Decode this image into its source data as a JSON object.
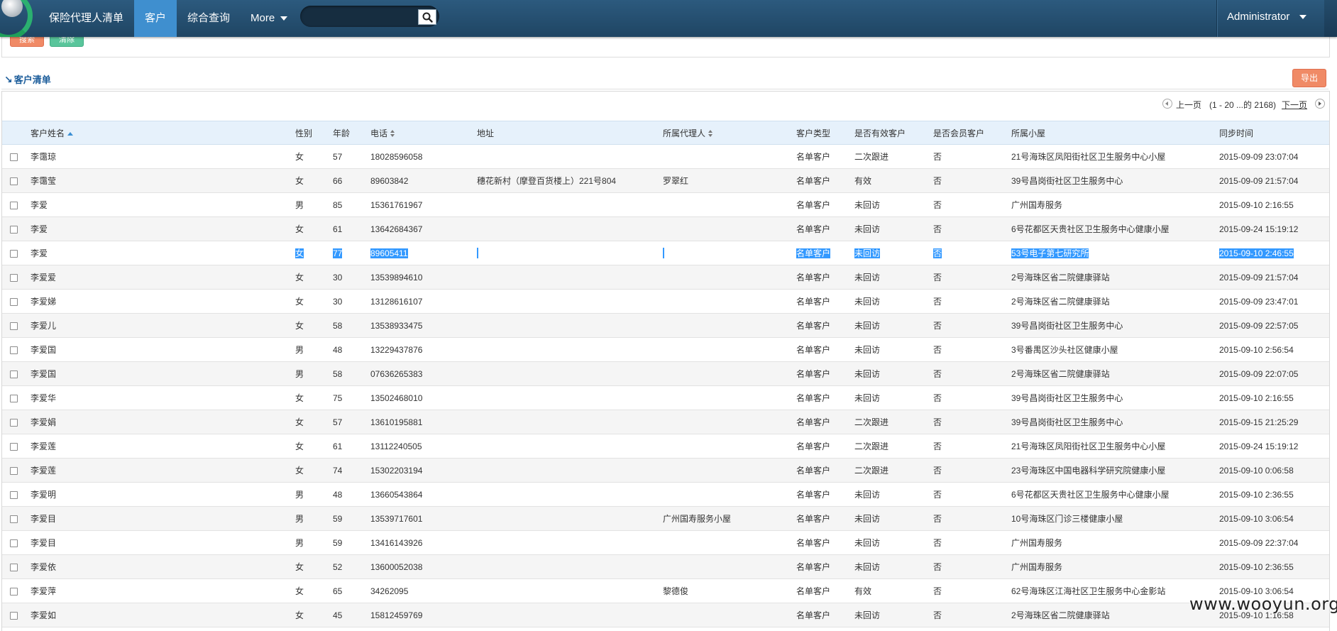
{
  "nav": {
    "app_title": "保险代理人清单",
    "items": [
      {
        "label": "客户",
        "active": true
      },
      {
        "label": "综合查询",
        "active": false
      },
      {
        "label": "More",
        "active": false
      }
    ],
    "search_placeholder": "",
    "user": "Administrator"
  },
  "search_panel": {
    "search_label": "搜索",
    "clear_label": "清除"
  },
  "list": {
    "title": "客户清单",
    "export_label": "导出"
  },
  "pager": {
    "prev_label": "上一页",
    "range_text": "(1 - 20 ...的 2168)",
    "next_label": "下一页"
  },
  "columns": [
    "客户姓名",
    "性别",
    "年龄",
    "电话",
    "地址",
    "所属代理人",
    "客户类型",
    "是否有效客户",
    "是否会员客户",
    "所属小屋",
    "同步时间"
  ],
  "rows": [
    {
      "name": "李霭琼",
      "sex": "女",
      "age": "57",
      "phone": "18028596058",
      "addr": "",
      "agent": "",
      "type": "名单客户",
      "valid": "二次跟进",
      "member": "否",
      "house": "21号海珠区凤阳街社区卫生服务中心小屋",
      "time": "2015-09-09 23:07:04"
    },
    {
      "name": "李霭莹",
      "sex": "女",
      "age": "66",
      "phone": "89603842",
      "addr": "穗花新村（摩登百货楼上）221号804",
      "agent": "罗翠红",
      "type": "名单客户",
      "valid": "有效",
      "member": "否",
      "house": "39号昌岗街社区卫生服务中心",
      "time": "2015-09-09 21:57:04"
    },
    {
      "name": "李爱",
      "sex": "男",
      "age": "85",
      "phone": "15361761967",
      "addr": "",
      "agent": "",
      "type": "名单客户",
      "valid": "未回访",
      "member": "否",
      "house": "广州国寿服务",
      "time": "2015-09-10 2:16:55"
    },
    {
      "name": "李爱",
      "sex": "女",
      "age": "61",
      "phone": "13642684367",
      "addr": "",
      "agent": "",
      "type": "名单客户",
      "valid": "未回访",
      "member": "否",
      "house": "6号花都区天贵社区卫生服务中心健康小屋",
      "time": "2015-09-24 15:19:12"
    },
    {
      "name": "李爱",
      "sex": "女",
      "age": "77",
      "phone": "89605411",
      "addr": "",
      "agent": "",
      "type": "名单客户",
      "valid": "未回访",
      "member": "否",
      "house": "53号电子第七研究所",
      "time": "2015-09-10 2:46:55",
      "selected": true
    },
    {
      "name": "李爱爱",
      "sex": "女",
      "age": "30",
      "phone": "13539894610",
      "addr": "",
      "agent": "",
      "type": "名单客户",
      "valid": "未回访",
      "member": "否",
      "house": "2号海珠区省二院健康驿站",
      "time": "2015-09-09 21:57:04"
    },
    {
      "name": "李爱娣",
      "sex": "女",
      "age": "30",
      "phone": "13128616107",
      "addr": "",
      "agent": "",
      "type": "名单客户",
      "valid": "未回访",
      "member": "否",
      "house": "2号海珠区省二院健康驿站",
      "time": "2015-09-09 23:47:01"
    },
    {
      "name": "李爱儿",
      "sex": "女",
      "age": "58",
      "phone": "13538933475",
      "addr": "",
      "agent": "",
      "type": "名单客户",
      "valid": "未回访",
      "member": "否",
      "house": "39号昌岗街社区卫生服务中心",
      "time": "2015-09-09 22:57:05"
    },
    {
      "name": "李爱国",
      "sex": "男",
      "age": "48",
      "phone": "13229437876",
      "addr": "",
      "agent": "",
      "type": "名单客户",
      "valid": "未回访",
      "member": "否",
      "house": "3号番禺区沙头社区健康小屋",
      "time": "2015-09-10 2:56:54"
    },
    {
      "name": "李爱国",
      "sex": "男",
      "age": "58",
      "phone": "07636265383",
      "addr": "",
      "agent": "",
      "type": "名单客户",
      "valid": "未回访",
      "member": "否",
      "house": "2号海珠区省二院健康驿站",
      "time": "2015-09-09 22:07:05"
    },
    {
      "name": "李爱华",
      "sex": "女",
      "age": "75",
      "phone": "13502468010",
      "addr": "",
      "agent": "",
      "type": "名单客户",
      "valid": "未回访",
      "member": "否",
      "house": "39号昌岗街社区卫生服务中心",
      "time": "2015-09-10 2:16:55"
    },
    {
      "name": "李爱娟",
      "sex": "女",
      "age": "57",
      "phone": "13610195881",
      "addr": "",
      "agent": "",
      "type": "名单客户",
      "valid": "二次跟进",
      "member": "否",
      "house": "39号昌岗街社区卫生服务中心",
      "time": "2015-09-15 21:25:29"
    },
    {
      "name": "李爱莲",
      "sex": "女",
      "age": "61",
      "phone": "13112240505",
      "addr": "",
      "agent": "",
      "type": "名单客户",
      "valid": "二次跟进",
      "member": "否",
      "house": "21号海珠区凤阳街社区卫生服务中心小屋",
      "time": "2015-09-24 15:19:12"
    },
    {
      "name": "李爱莲",
      "sex": "女",
      "age": "74",
      "phone": "15302203194",
      "addr": "",
      "agent": "",
      "type": "名单客户",
      "valid": "二次跟进",
      "member": "否",
      "house": "23号海珠区中国电器科学研究院健康小屋",
      "time": "2015-09-10 0:06:58"
    },
    {
      "name": "李爱明",
      "sex": "男",
      "age": "48",
      "phone": "13660543864",
      "addr": "",
      "agent": "",
      "type": "名单客户",
      "valid": "未回访",
      "member": "否",
      "house": "6号花都区天贵社区卫生服务中心健康小屋",
      "time": "2015-09-10 2:36:55"
    },
    {
      "name": "李爱目",
      "sex": "男",
      "age": "59",
      "phone": "13539717601",
      "addr": "",
      "agent": "广州国寿服务小屋",
      "type": "名单客户",
      "valid": "未回访",
      "member": "否",
      "house": "10号海珠区门诊三楼健康小屋",
      "time": "2015-09-10 3:06:54"
    },
    {
      "name": "李爱目",
      "sex": "男",
      "age": "59",
      "phone": "13416143926",
      "addr": "",
      "agent": "",
      "type": "名单客户",
      "valid": "未回访",
      "member": "否",
      "house": "广州国寿服务",
      "time": "2015-09-09 22:37:04"
    },
    {
      "name": "李爱依",
      "sex": "女",
      "age": "52",
      "phone": "13600052038",
      "addr": "",
      "agent": "",
      "type": "名单客户",
      "valid": "未回访",
      "member": "否",
      "house": "广州国寿服务",
      "time": "2015-09-10 2:36:55"
    },
    {
      "name": "李爱萍",
      "sex": "女",
      "age": "65",
      "phone": "34262095",
      "addr": "",
      "agent": "黎德俊",
      "type": "名单客户",
      "valid": "有效",
      "member": "否",
      "house": "62号海珠区江海社区卫生服务中心金影站",
      "time": "2015-09-10 3:06:54"
    },
    {
      "name": "李爱如",
      "sex": "女",
      "age": "45",
      "phone": "15812459769",
      "addr": "",
      "agent": "",
      "type": "名单客户",
      "valid": "未回访",
      "member": "否",
      "house": "2号海珠区省二院健康驿站",
      "time": "2015-09-10 1:16:58"
    }
  ],
  "watermark": "www.wooyun.org"
}
